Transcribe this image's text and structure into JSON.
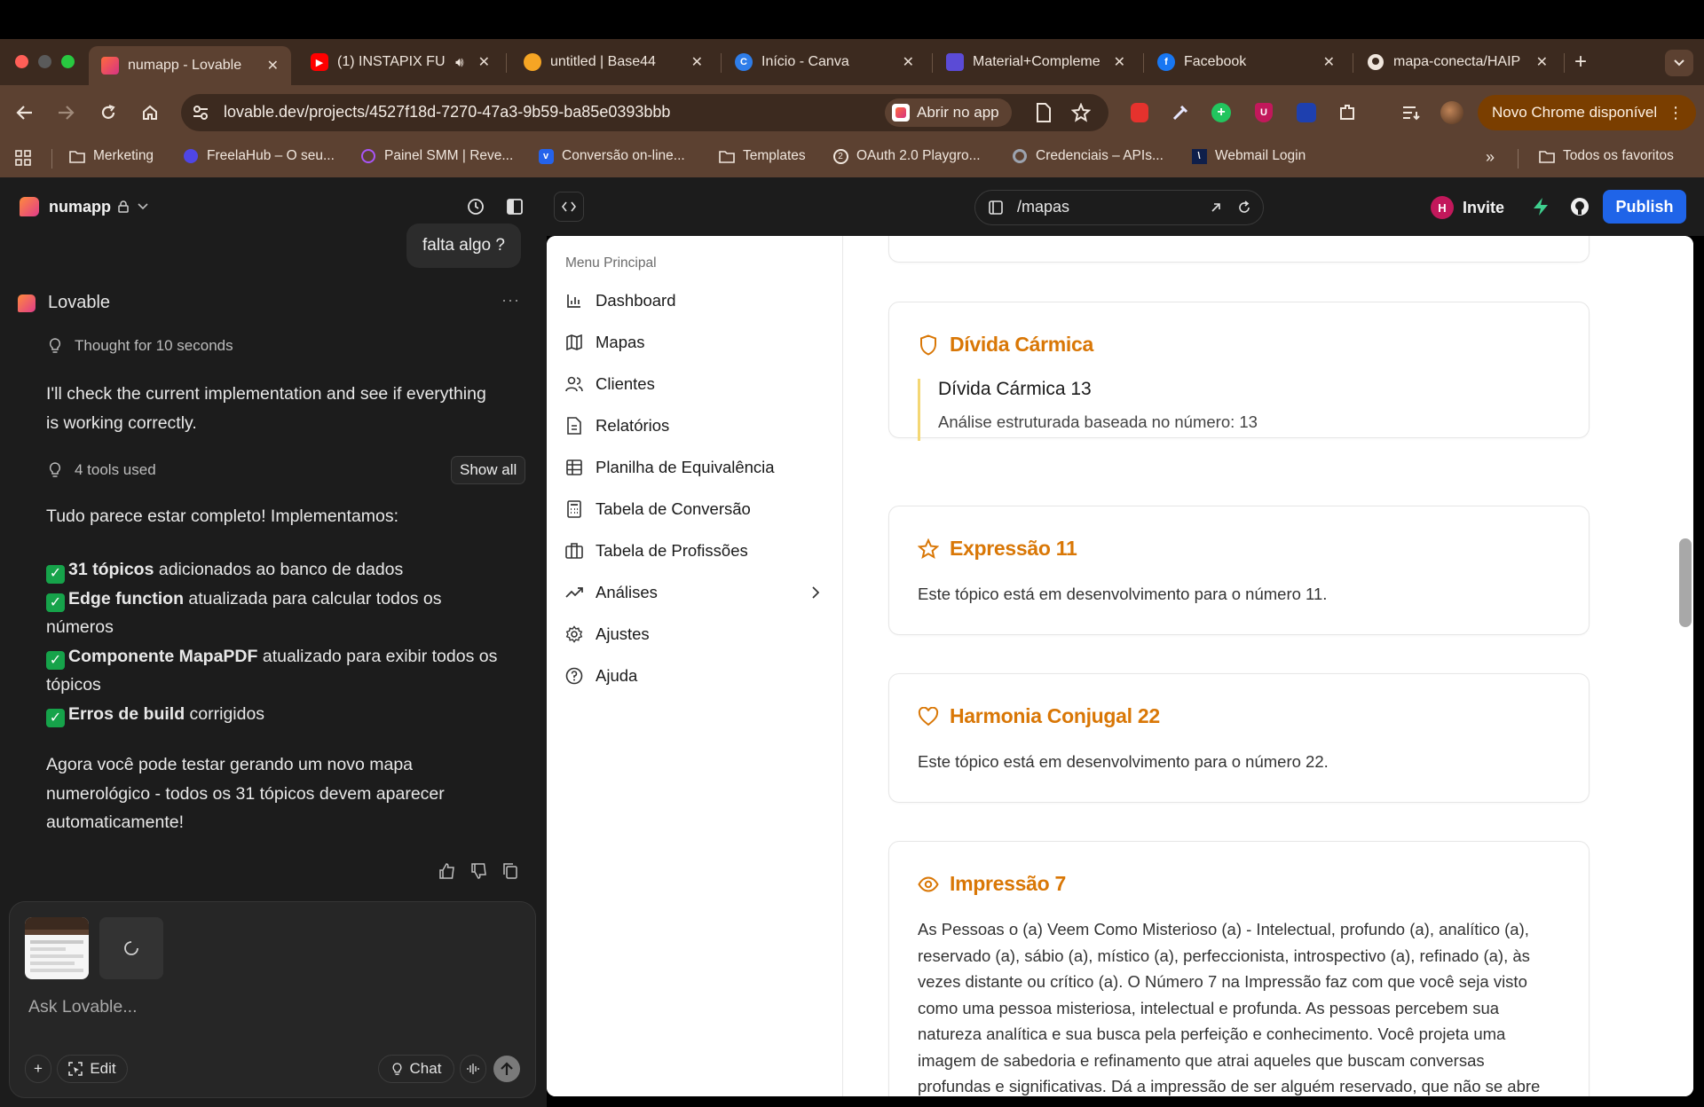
{
  "browser": {
    "tabs": [
      {
        "title": "numapp - Lovable",
        "active": true
      },
      {
        "title": "(1) INSTAPIX FU"
      },
      {
        "title": "untitled | Base44"
      },
      {
        "title": "Início - Canva"
      },
      {
        "title": "Material+Compleme"
      },
      {
        "title": "Facebook"
      },
      {
        "title": "mapa-conecta/HAIP"
      }
    ],
    "url": "lovable.dev/projects/4527f18d-7270-47a3-9b59-ba85e0393bbb",
    "open_in_app": "Abrir no app",
    "chrome_update": "Novo Chrome disponível",
    "bookmarks": [
      "Merketing",
      "FreelaHub – O seu...",
      "Painel SMM | Reve...",
      "Conversão on-line...",
      "Templates",
      "OAuth 2.0 Playgro...",
      "Credenciais – APIs...",
      "Webmail Login"
    ],
    "all_bookmarks": "Todos os favoritos",
    "more_bookmarks": "»"
  },
  "app": {
    "project_name": "numapp",
    "route": "/mapas",
    "invite_avatar": "H",
    "invite_label": "Invite",
    "publish_label": "Publish"
  },
  "chat": {
    "user_message": "falta algo ?",
    "assistant_name": "Lovable",
    "more": "···",
    "thought": "Thought for 10 seconds",
    "intro": [
      "I'll check the current implementation and see if everything",
      "is working correctly."
    ],
    "tools_used": "4 tools used",
    "show_all": "Show all",
    "summary_heading": "Tudo parece estar completo! Implementamos:",
    "items": [
      {
        "bold": "31 tópicos",
        "rest": " adicionados ao banco de dados"
      },
      {
        "bold": "Edge function",
        "rest": " atualizada para calcular todos os",
        "cont": "números"
      },
      {
        "bold": "Componente MapaPDF",
        "rest": " atualizado para exibir todos os",
        "cont": "tópicos"
      },
      {
        "bold": "Erros de build",
        "rest": " corrigidos"
      }
    ],
    "closing": [
      "Agora você pode testar gerando um novo mapa",
      "numerológico - todos os 31 tópicos devem aparecer",
      "automaticamente!"
    ],
    "check_glyph": "✓",
    "input_placeholder": "Ask Lovable...",
    "add_glyph": "+",
    "edit_label": "Edit",
    "chat_label": "Chat"
  },
  "sidebar": {
    "title": "Menu Principal",
    "items": [
      {
        "label": "Dashboard",
        "icon": "bar-chart-icon"
      },
      {
        "label": "Mapas",
        "icon": "map-icon"
      },
      {
        "label": "Clientes",
        "icon": "users-icon"
      },
      {
        "label": "Relatórios",
        "icon": "file-text-icon"
      },
      {
        "label": "Planilha de Equivalência",
        "icon": "table-icon"
      },
      {
        "label": "Tabela de Conversão",
        "icon": "calculator-icon"
      },
      {
        "label": "Tabela de Profissões",
        "icon": "briefcase-icon"
      },
      {
        "label": "Análises",
        "icon": "trending-up-icon"
      },
      {
        "label": "Ajustes",
        "icon": "gear-icon"
      },
      {
        "label": "Ajuda",
        "icon": "help-circle-icon"
      }
    ]
  },
  "cards": [
    {
      "title": "Dívida Cármica",
      "icon": "shield-icon",
      "sub_title": "Dívida Cármica 13",
      "sub_text": "Análise estruturada baseada no número: 13"
    },
    {
      "title": "Expressão 11",
      "icon": "star-icon",
      "text": "Este tópico está em desenvolvimento para o número 11."
    },
    {
      "title": "Harmonia Conjugal 22",
      "icon": "heart-icon",
      "text": "Este tópico está em desenvolvimento para o número 22."
    },
    {
      "title": "Impressão 7",
      "icon": "eye-icon",
      "lines": [
        "As Pessoas o (a) Veem Como Misterioso (a) - Intelectual, profundo (a), analítico (a),",
        "reservado (a), sábio (a), místico (a), perfeccionista, introspectivo (a), refinado (a), às",
        "vezes distante ou crítico (a). O Número 7 na Impressão faz com que você seja visto",
        "como uma pessoa misteriosa, intelectual e profunda. As pessoas percebem sua",
        "natureza analítica e sua busca pela perfeição e conhecimento. Você projeta uma",
        "imagem de sabedoria e refinamento que atrai aqueles que buscam conversas",
        "profundas e significativas. Dá a impressão de ser alguém reservado, que não se abre"
      ]
    }
  ],
  "colors": {
    "accent": "#d97706",
    "publish": "#1f64e8",
    "tabstrip": "#3c2a1f",
    "toolbar": "#5c4131"
  }
}
